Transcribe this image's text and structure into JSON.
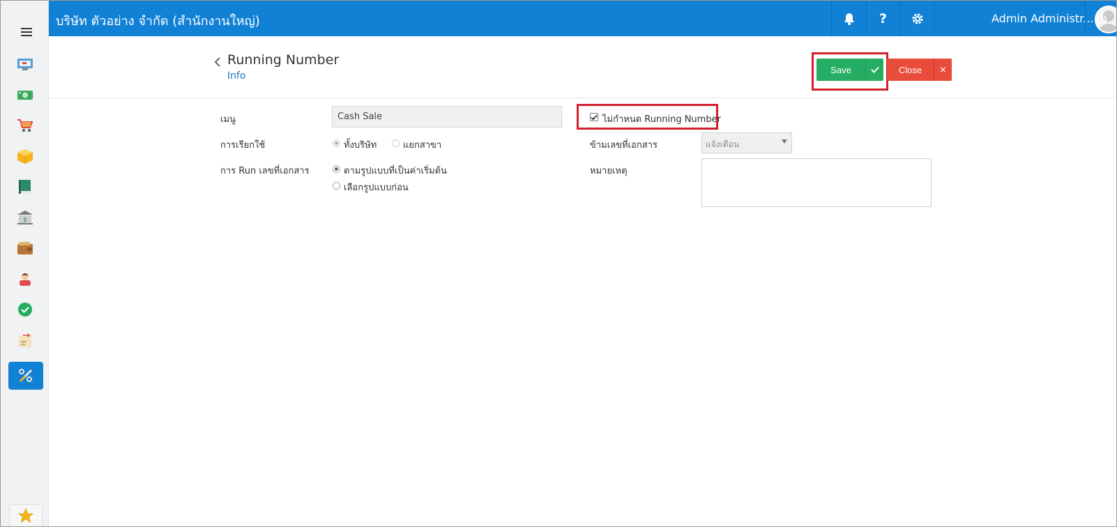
{
  "header": {
    "company": "บริษัท ตัวอย่าง จำกัด (สำนักงานใหญ่)",
    "user_name": "Admin Administr...",
    "help_label": "?"
  },
  "sidebar": {
    "items": [
      {
        "icon": "monitor-icon"
      },
      {
        "icon": "money-icon"
      },
      {
        "icon": "cart-icon"
      },
      {
        "icon": "box-icon"
      },
      {
        "icon": "book-icon"
      },
      {
        "icon": "bank-icon"
      },
      {
        "icon": "wallet-icon"
      },
      {
        "icon": "person-icon"
      },
      {
        "icon": "check-circle-icon"
      },
      {
        "icon": "transfer-icon"
      },
      {
        "icon": "tools-icon",
        "active": true
      }
    ],
    "favorite_icon": "star-icon"
  },
  "page": {
    "title": "Running Number",
    "subtitle": "Info",
    "save_label": "Save",
    "close_label": "Close",
    "close_x": "×"
  },
  "form": {
    "menu_label": "เมนู",
    "menu_value": "Cash Sale",
    "usage_label": "การเรียกใช้",
    "usage_options": [
      "ทั้งบริษัท",
      "แยกสาขา"
    ],
    "run_label": "การ Run เลขที่เอกสาร",
    "run_options": [
      "ตามรูปแบบที่เป็นค่าเริ่มต้น",
      "เลือกรูปแบบก่อน"
    ],
    "no_running_label": "ไม่กำหนด Running Number",
    "no_running_checked": true,
    "skip_label": "ข้ามเลขที่เอกสาร",
    "skip_value": "แจ้งเตือน",
    "remark_label": "หมายเหตุ",
    "remark_value": ""
  },
  "colors": {
    "topbar": "#1181d6",
    "save": "#25ae63",
    "close": "#e94c3b",
    "highlight": "#d3202b"
  }
}
